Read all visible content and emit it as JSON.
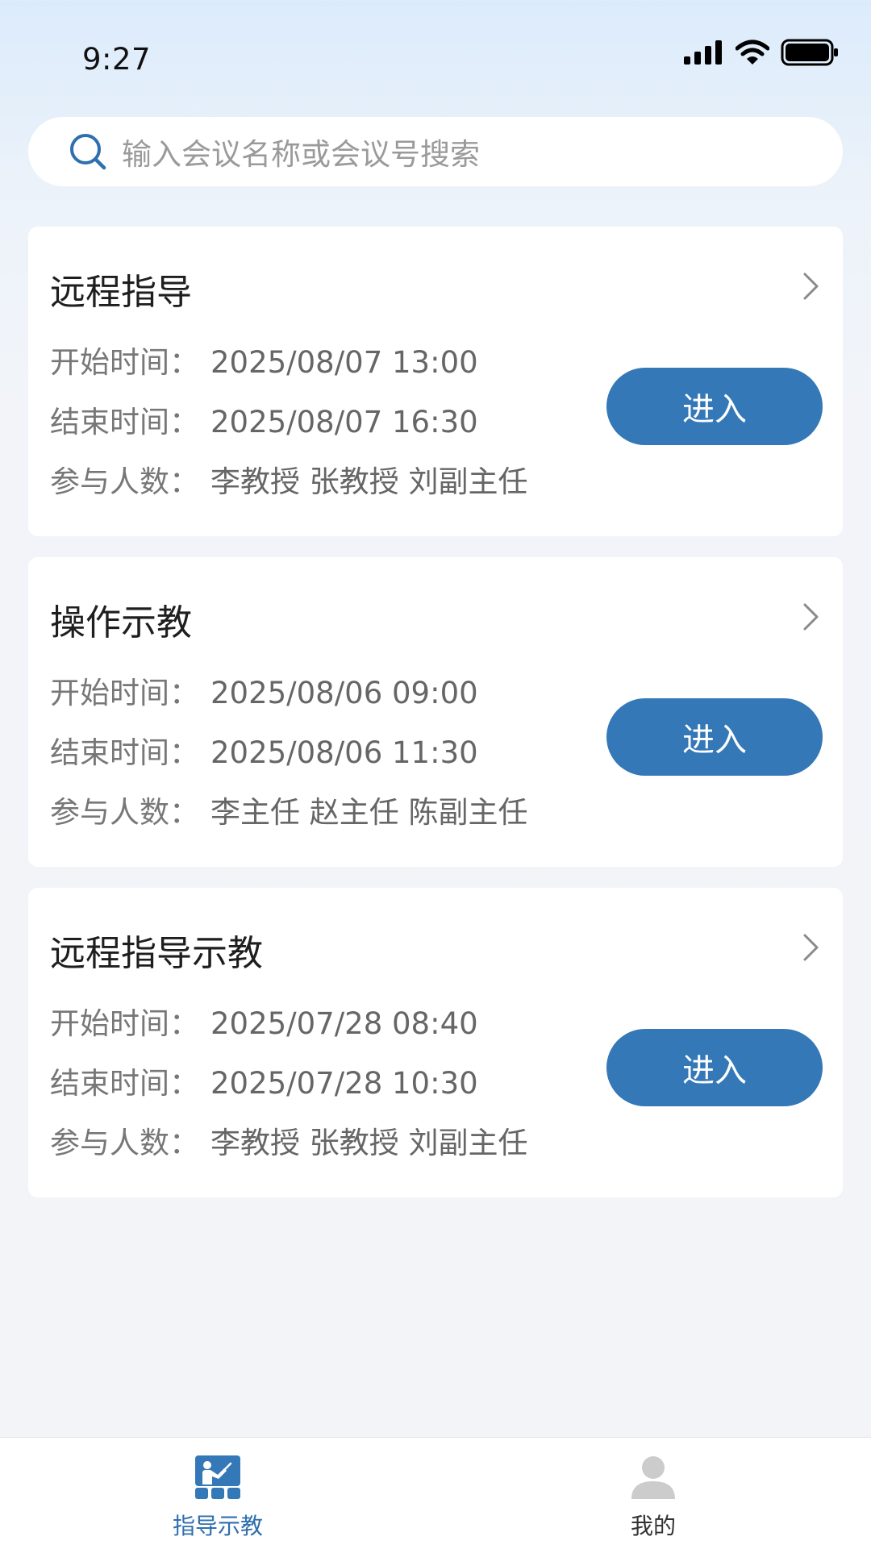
{
  "status_bar": {
    "time": "9:27"
  },
  "search": {
    "placeholder": "输入会议名称或会议号搜索"
  },
  "meetings": [
    {
      "title": "远程指导",
      "start_label": "开始时间：",
      "start": "2025/08/07 13:00",
      "end_label": "结束时间：",
      "end": "2025/08/07 16:30",
      "participants_label": "参与人数：",
      "participants": "李教授 张教授 刘副主任",
      "button": "进入"
    },
    {
      "title": "操作示教",
      "start_label": "开始时间：",
      "start": "2025/08/06 09:00",
      "end_label": "结束时间：",
      "end": "2025/08/06 11:30",
      "participants_label": "参与人数：",
      "participants": "李主任 赵主任 陈副主任",
      "button": "进入"
    },
    {
      "title": "远程指导示教",
      "start_label": "开始时间：",
      "start": "2025/07/28 08:40",
      "end_label": "结束时间：",
      "end": "2025/07/28 10:30",
      "participants_label": "参与人数：",
      "participants": "李教授 张教授 刘副主任",
      "button": "进入"
    }
  ],
  "tab_bar": {
    "tabs": [
      {
        "label": "指导示教",
        "icon": "teaching-icon",
        "active": true
      },
      {
        "label": "我的",
        "icon": "profile-icon",
        "active": false
      }
    ]
  },
  "colors": {
    "accent": "#3478b7",
    "active_tab": "#2f6fad",
    "inactive_icon": "#cccccc"
  }
}
